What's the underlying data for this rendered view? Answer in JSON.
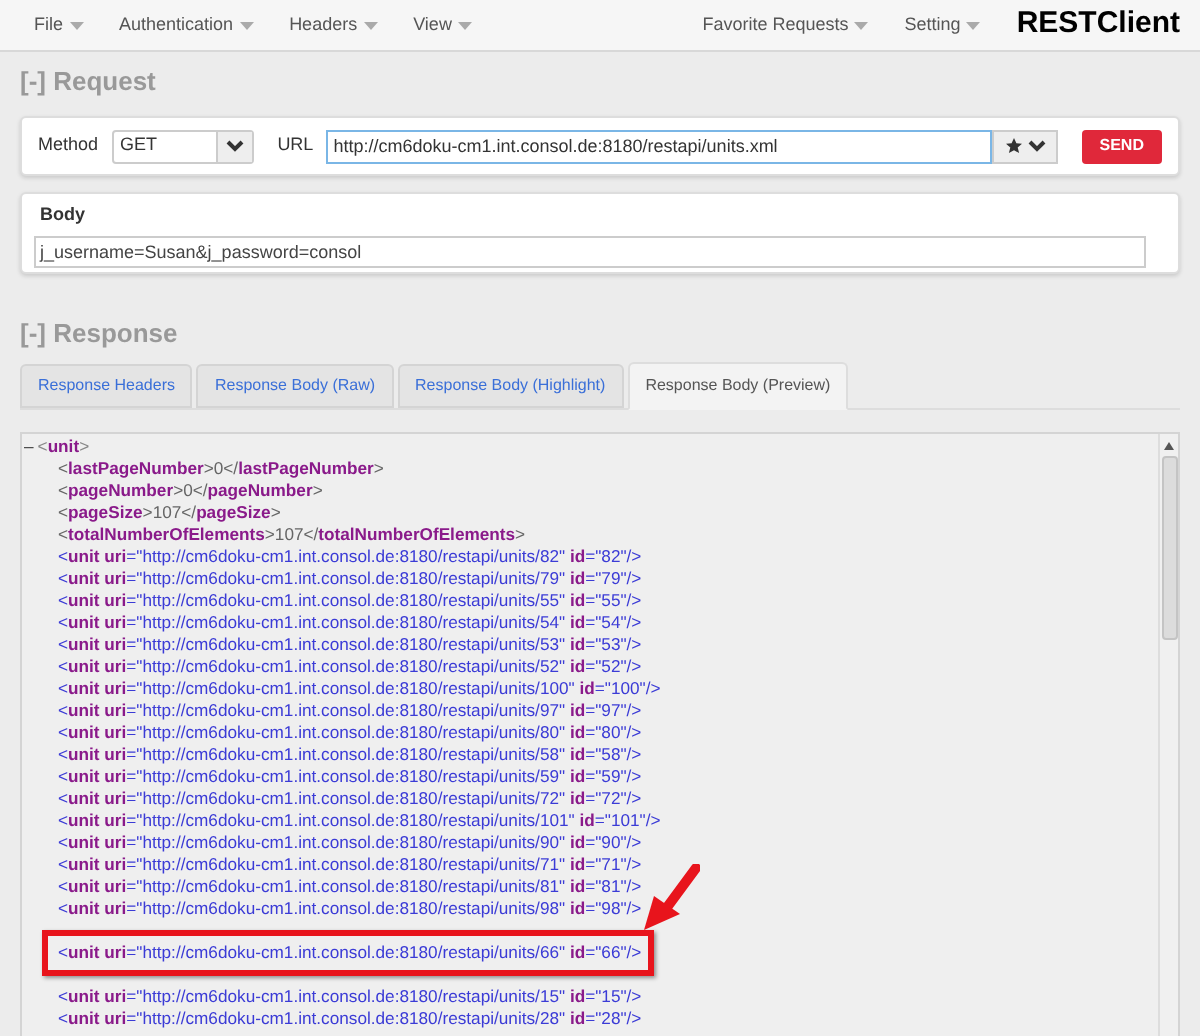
{
  "menu": {
    "left": [
      "File",
      "Authentication",
      "Headers",
      "View"
    ],
    "right": [
      "Favorite Requests",
      "Setting"
    ],
    "brand": "RESTClient"
  },
  "request": {
    "heading": "[-] Request",
    "method_label": "Method",
    "method": "GET",
    "url_label": "URL",
    "url": "http://cm6doku-cm1.int.consol.de:8180/restapi/units.xml",
    "send": "SEND",
    "body_title": "Body",
    "body": "j_username=Susan&j_password=consol"
  },
  "response": {
    "heading": "[-] Response",
    "tabs": [
      {
        "label": "Response Headers",
        "selected": false
      },
      {
        "label": "Response Body (Raw)",
        "selected": false
      },
      {
        "label": "Response Body (Highlight)",
        "selected": false
      },
      {
        "label": "Response Body (Preview)",
        "selected": true
      }
    ],
    "tree": {
      "toggle": "–",
      "line": "<**unit**>",
      "expanded": true,
      "children": [
        {
          "kind": "element",
          "line": "<**lastPageNumber**>0</**lastPageNumber**>"
        },
        {
          "kind": "element",
          "line": "<**pageNumber**>0</**pageNumber**>"
        },
        {
          "kind": "element",
          "line": "<**pageSize**>107</**pageSize**>"
        },
        {
          "kind": "element",
          "line": "<**totalNumberOfElements**>107</**totalNumberOfElements**>"
        },
        {
          "kind": "unit",
          "line": "<**unit** **uri**=\"http://cm6doku-cm1.int.consol.de:8180/restapi/units/82\" **id**=\"82\"/>",
          "highlighted": false
        },
        {
          "kind": "unit",
          "line": "<**unit** **uri**=\"http://cm6doku-cm1.int.consol.de:8180/restapi/units/79\" **id**=\"79\"/>",
          "highlighted": false
        },
        {
          "kind": "unit",
          "line": "<**unit** **uri**=\"http://cm6doku-cm1.int.consol.de:8180/restapi/units/55\" **id**=\"55\"/>",
          "highlighted": false
        },
        {
          "kind": "unit",
          "line": "<**unit** **uri**=\"http://cm6doku-cm1.int.consol.de:8180/restapi/units/54\" **id**=\"54\"/>",
          "highlighted": false
        },
        {
          "kind": "unit",
          "line": "<**unit** **uri**=\"http://cm6doku-cm1.int.consol.de:8180/restapi/units/53\" **id**=\"53\"/>",
          "highlighted": false
        },
        {
          "kind": "unit",
          "line": "<**unit** **uri**=\"http://cm6doku-cm1.int.consol.de:8180/restapi/units/52\" **id**=\"52\"/>",
          "highlighted": false
        },
        {
          "kind": "unit",
          "line": "<**unit** **uri**=\"http://cm6doku-cm1.int.consol.de:8180/restapi/units/100\" **id**=\"100\"/>",
          "highlighted": false
        },
        {
          "kind": "unit",
          "line": "<**unit** **uri**=\"http://cm6doku-cm1.int.consol.de:8180/restapi/units/97\" **id**=\"97\"/>",
          "highlighted": false
        },
        {
          "kind": "unit",
          "line": "<**unit** **uri**=\"http://cm6doku-cm1.int.consol.de:8180/restapi/units/80\" **id**=\"80\"/>",
          "highlighted": false
        },
        {
          "kind": "unit",
          "line": "<**unit** **uri**=\"http://cm6doku-cm1.int.consol.de:8180/restapi/units/58\" **id**=\"58\"/>",
          "highlighted": false
        },
        {
          "kind": "unit",
          "line": "<**unit** **uri**=\"http://cm6doku-cm1.int.consol.de:8180/restapi/units/59\" **id**=\"59\"/>",
          "highlighted": false
        },
        {
          "kind": "unit",
          "line": "<**unit** **uri**=\"http://cm6doku-cm1.int.consol.de:8180/restapi/units/72\" **id**=\"72\"/>",
          "highlighted": false
        },
        {
          "kind": "unit",
          "line": "<**unit** **uri**=\"http://cm6doku-cm1.int.consol.de:8180/restapi/units/101\" **id**=\"101\"/>",
          "highlighted": false
        },
        {
          "kind": "unit",
          "line": "<**unit** **uri**=\"http://cm6doku-cm1.int.consol.de:8180/restapi/units/90\" **id**=\"90\"/>",
          "highlighted": false
        },
        {
          "kind": "unit",
          "line": "<**unit** **uri**=\"http://cm6doku-cm1.int.consol.de:8180/restapi/units/71\" **id**=\"71\"/>",
          "highlighted": false
        },
        {
          "kind": "unit",
          "line": "<**unit** **uri**=\"http://cm6doku-cm1.int.consol.de:8180/restapi/units/81\" **id**=\"81\"/>",
          "highlighted": false
        },
        {
          "kind": "unit",
          "line": "<**unit** **uri**=\"http://cm6doku-cm1.int.consol.de:8180/restapi/units/98\" **id**=\"98\"/>",
          "highlighted": false
        },
        {
          "kind": "covered"
        },
        {
          "kind": "unit",
          "line": "<**unit** **uri**=\"http://cm6doku-cm1.int.consol.de:8180/restapi/units/66\" **id**=\"66\"/>",
          "highlighted": true
        },
        {
          "kind": "covered"
        },
        {
          "kind": "unit",
          "line": "<**unit** **uri**=\"http://cm6doku-cm1.int.consol.de:8180/restapi/units/15\" **id**=\"15\"/>",
          "highlighted": false
        },
        {
          "kind": "unit",
          "line": "<**unit** **uri**=\"http://cm6doku-cm1.int.consol.de:8180/restapi/units/28\" **id**=\"28\"/>",
          "highlighted": false
        }
      ]
    }
  }
}
